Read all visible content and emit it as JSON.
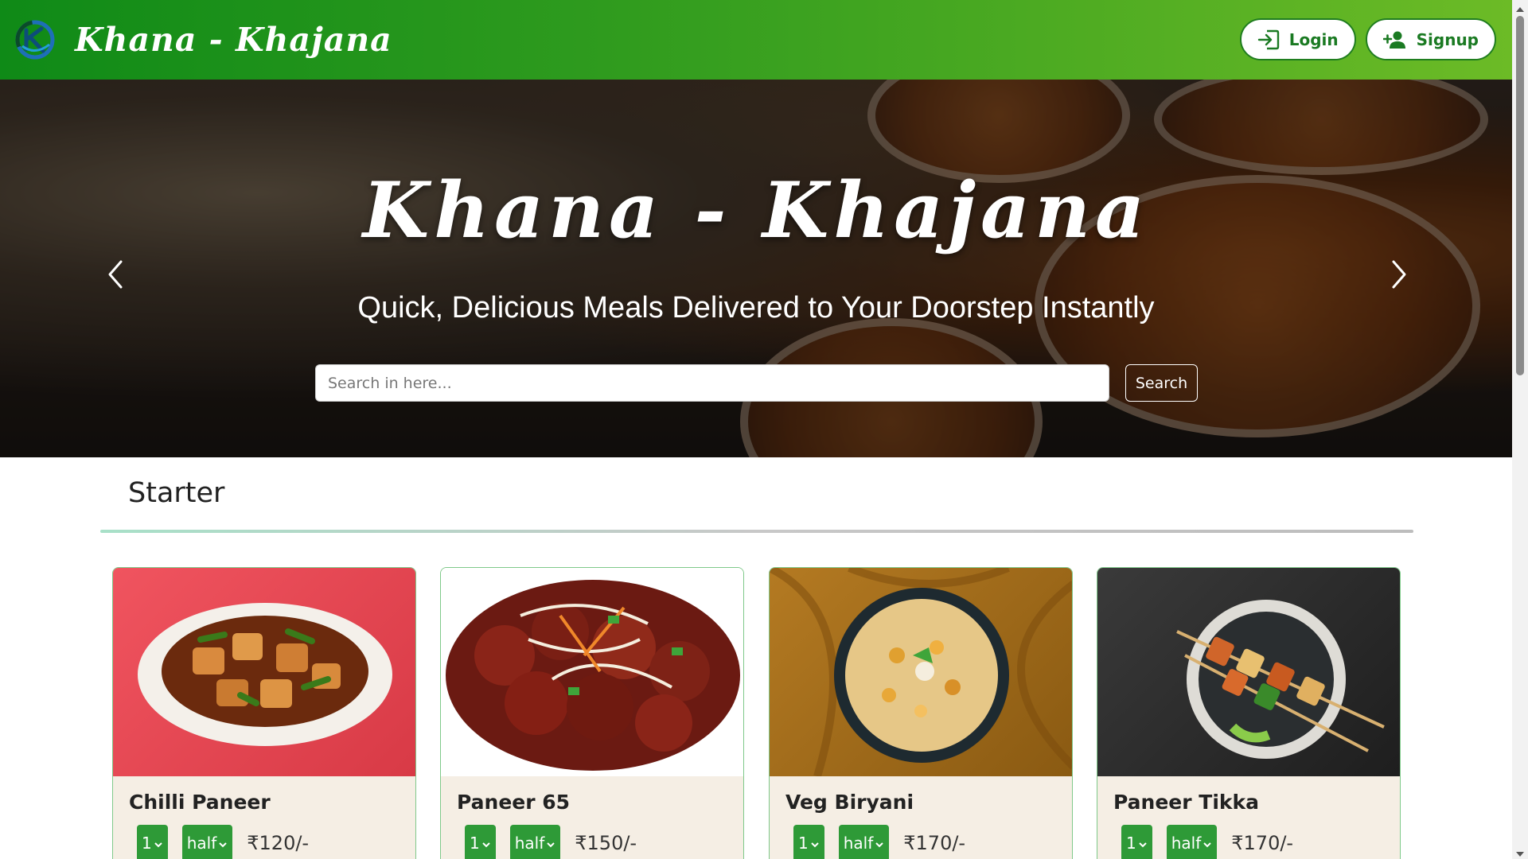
{
  "navbar": {
    "brand": "Khana - Khajana",
    "login_label": "Login",
    "signup_label": "Signup",
    "accent": "#1a7a22"
  },
  "hero": {
    "title": "Khana - Khajana",
    "subtitle": "Quick, Delicious Meals Delivered to Your Doorstep Instantly",
    "search_placeholder": "Search in here...",
    "search_button": "Search"
  },
  "section": {
    "title": "Starter"
  },
  "cards": [
    {
      "name": "Chilli Paneer",
      "qty": "1",
      "size": "half",
      "price": "₹120/-"
    },
    {
      "name": "Paneer 65",
      "qty": "1",
      "size": "half",
      "price": "₹150/-"
    },
    {
      "name": "Veg Biryani",
      "qty": "1",
      "size": "half",
      "price": "₹170/-"
    },
    {
      "name": "Paneer Tikka",
      "qty": "1",
      "size": "half",
      "price": "₹170/-"
    }
  ]
}
